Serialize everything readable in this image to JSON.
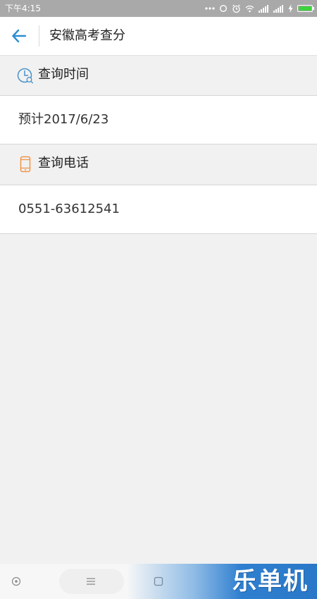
{
  "status_bar": {
    "time": "下午4:15",
    "icons": [
      "dots-icon",
      "sync-icon",
      "alarm-icon",
      "wifi-icon",
      "signal-icon",
      "signal-icon",
      "charging-icon",
      "battery-icon"
    ]
  },
  "app_bar": {
    "title": "安徽高考查分",
    "back_icon": "back-arrow-icon"
  },
  "sections": [
    {
      "header": "查询时间",
      "icon": "clock-icon",
      "icon_color": "#4a93c9",
      "value": "预计2017/6/23"
    },
    {
      "header": "查询电话",
      "icon": "phone-icon",
      "icon_color": "#f0954a",
      "value": "0551-63612541"
    }
  ],
  "nav_bar": {
    "buttons": [
      "back-nav-icon",
      "menu-nav-icon",
      "home-nav-icon"
    ]
  },
  "watermark": {
    "text": "乐单机"
  },
  "colors": {
    "accent": "#2b8fd0",
    "status_bar": "#a9a9a9",
    "background": "#f1f1f1"
  }
}
